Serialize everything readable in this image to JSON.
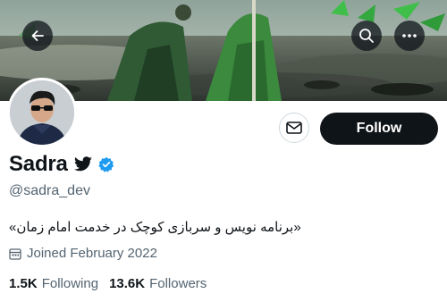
{
  "header": {
    "back_icon": "arrow-left-icon",
    "search_icon": "search-icon",
    "more_icon": "more-horizontal-icon"
  },
  "profile": {
    "display_name": "Sadra",
    "name_emoji": "bird-icon",
    "verified": true,
    "handle": "@sadra_dev",
    "bio": "«برنامه نویس و سربازی کوچک در خدمت امام زمان»",
    "joined": "Joined February 2022",
    "following_count": "1.5K",
    "following_label": "Following",
    "followers_count": "13.6K",
    "followers_label": "Followers"
  },
  "actions": {
    "message_icon": "envelope-icon",
    "follow_label": "Follow"
  },
  "colors": {
    "accent": "#1d9bf0",
    "button_dark": "#0f1419",
    "secondary_text": "#536471"
  }
}
